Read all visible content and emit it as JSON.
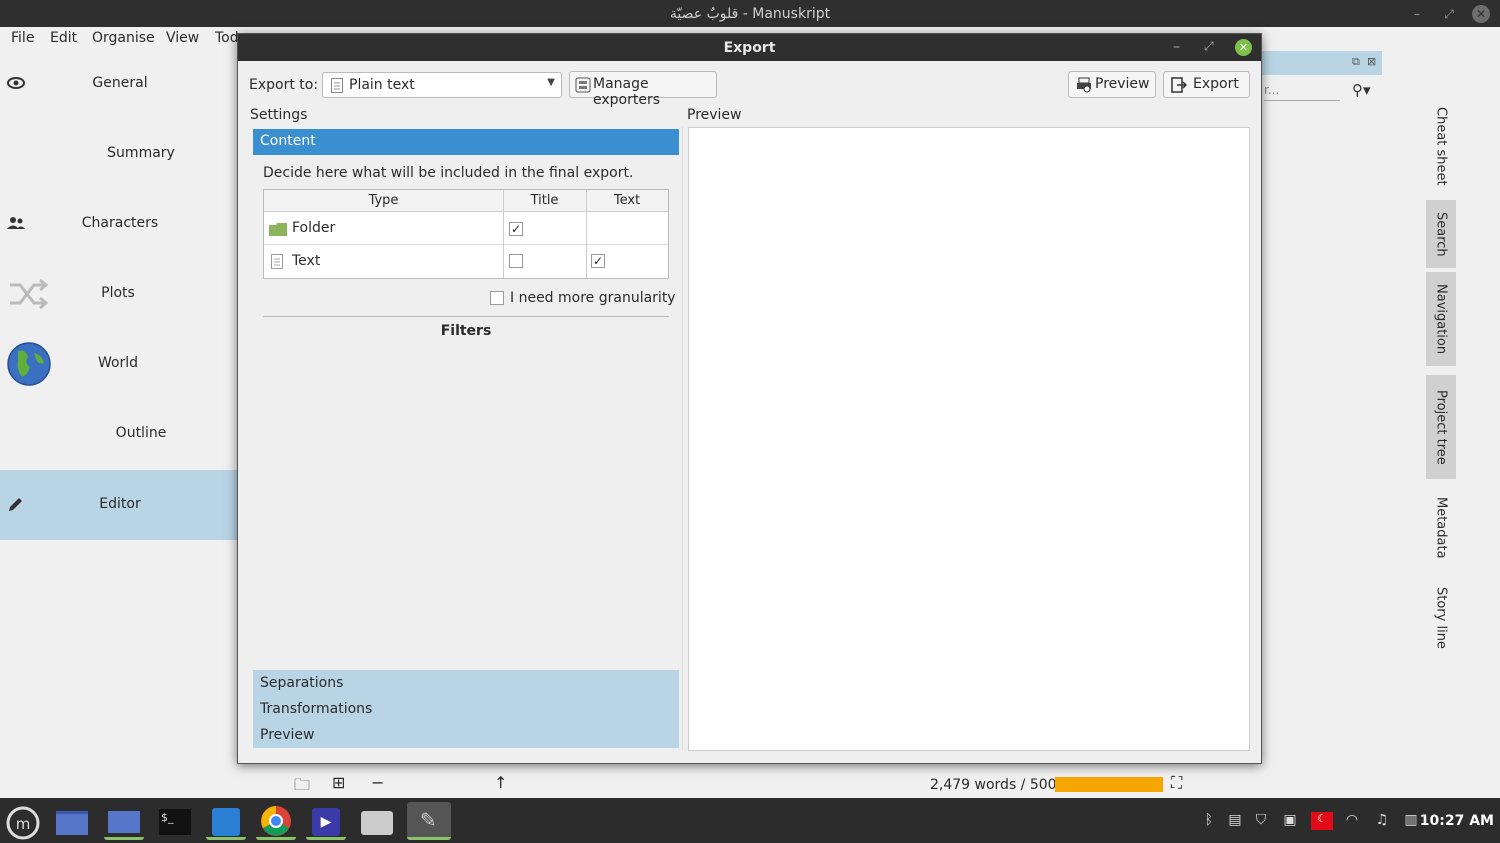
{
  "window": {
    "title": "قلوبٌ عصيّة - Manuskript"
  },
  "menu": {
    "file": "File",
    "edit": "Edit",
    "organise": "Organise",
    "view": "View",
    "tools_partial": "Tod"
  },
  "nav": {
    "items": [
      {
        "label": "General",
        "icon": "eye-icon"
      },
      {
        "label": "Summary",
        "icon": ""
      },
      {
        "label": "Characters",
        "icon": "people-icon"
      },
      {
        "label": "Plots",
        "icon": "shuffle-icon"
      },
      {
        "label": "World",
        "icon": "globe-icon"
      },
      {
        "label": "Outline",
        "icon": ""
      },
      {
        "label": "Editor",
        "icon": "pencil-icon",
        "active": true
      }
    ]
  },
  "right_panel": {
    "filter_placeholder": "r...",
    "tabs": [
      "Cheat sheet",
      "Search",
      "Navigation",
      "Project tree",
      "Metadata",
      "Story line"
    ]
  },
  "status": {
    "words": "2,479  words / 500",
    "progress_fraction": 1.0,
    "progress_color": "#f5a600"
  },
  "dialog": {
    "title": "Export",
    "export_to_label": "Export to:",
    "exporter_selected": "Plain text",
    "manage_exporters": "Manage exporters",
    "preview_button": "Preview",
    "export_button": "Export",
    "settings_label": "Settings",
    "preview_label": "Preview",
    "content_header": "Content",
    "description": "Decide here what will be included in the final export.",
    "table": {
      "columns": [
        "Type",
        "Title",
        "Text"
      ],
      "rows": [
        {
          "type": "Folder",
          "title_checked": true,
          "text_checked": null
        },
        {
          "type": "Text",
          "title_checked": false,
          "text_checked": true
        }
      ]
    },
    "granularity_label": "I need more granularity",
    "granularity_checked": false,
    "filters_label": "Filters",
    "sections": [
      "Separations",
      "Transformations",
      "Preview"
    ],
    "accent_color": "#3a8fd1"
  },
  "taskbar": {
    "time": "10:27 AM"
  }
}
